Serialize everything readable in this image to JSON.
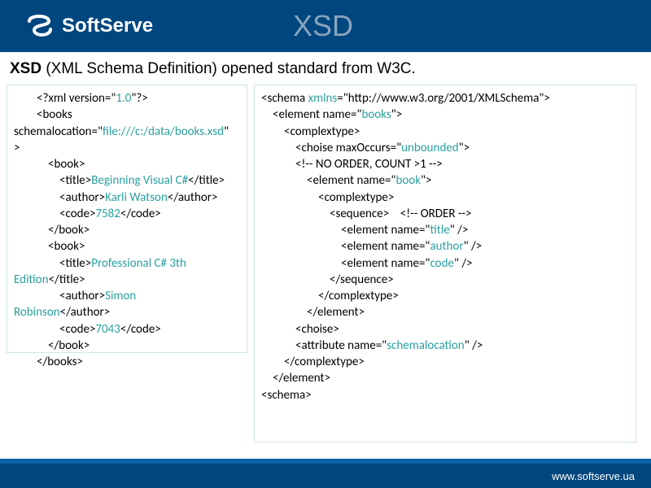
{
  "header": {
    "brand": "SoftServe",
    "title": "XSD"
  },
  "subtitle": {
    "b": "XSD",
    "rest": " (XML Schema Definition) opened standard from W3C."
  },
  "xml": {
    "declOpen": "<?xml version=\"",
    "ver": "1.0",
    "declClose": "\"?>",
    "booksOpen": "<books",
    "slAttr1": "schemalocation=\"",
    "slVal": "file:///c:/data/books.xsd",
    "qgt": "\">",
    "bookOpen": "<book>",
    "titleOpen": "<title>",
    "t1": "Beginning Visual C#",
    "titleClose": "</title>",
    "authorOpen": "<author>",
    "a1": "Karli Watson",
    "authorClose": "</author>",
    "codeOpen": "<code>",
    "c1": "7582",
    "codeClose": "</code>",
    "bookClose": "</book>",
    "t2a": "Professional C# 3th ",
    "t2b": "Edition",
    "a2a": "Simon ",
    "a2b": "Robinson",
    "c2": "7043",
    "booksClose": "</books>"
  },
  "xsd": {
    "schemaOpen1": "<schema ",
    "xmlnsKey": "xmlns",
    "eq": "=\"",
    "xmlnsVal": "http://www.w3.org/2001/XMLSchema",
    "qgt": "\">",
    "elName": "<element name=\"",
    "booksVal": "books",
    "ctOpen": "<complextype>",
    "choiseOpen": "<choise maxOccurs=\"",
    "unbounded": "unbounded",
    "comment1": "<!-- NO ORDER, COUNT >1 -->",
    "bookVal": "book",
    "seqOpen": "<sequence>",
    "commentOrder": "<!-- ORDER -->",
    "titleVal": "title",
    "authorVal": "author",
    "codeVal": "code",
    "selfClose": "\" />",
    "seqClose": "</sequence>",
    "ctClose": "</complextype>",
    "elClose": "</element>",
    "choiseClose": "<choise>",
    "attrName": "<attribute name=\"",
    "schemalocation": "schemalocation",
    "schemaClose": "<schema>"
  },
  "footer": {
    "url": "www.softserve.ua"
  }
}
